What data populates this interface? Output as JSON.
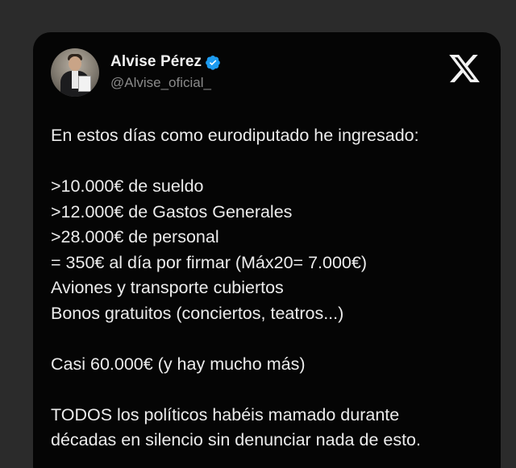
{
  "author": {
    "display_name": "Alvise Pérez",
    "handle": "@Alvise_oficial_",
    "verified_icon": "verified-badge-icon",
    "avatar_icon": "profile-photo"
  },
  "platform": {
    "logo_icon": "x-logo-icon"
  },
  "colors": {
    "background": "#2b2b2b",
    "card": "#050505",
    "text": "#ececec",
    "handle": "#8a8a8a",
    "verified": "#1d9bf0"
  },
  "tweet": {
    "intro": "En estos días como eurodiputado he ingresado:",
    "items": [
      ">10.000€ de sueldo",
      ">12.000€ de Gastos Generales",
      ">28.000€ de personal",
      "= 350€ al día por firmar (Máx20= 7.000€)",
      "Aviones y transporte cubiertos",
      "Bonos gratuitos (conciertos, teatros...)"
    ],
    "total": "Casi 60.000€ (y hay mucho más)",
    "closing_lines": [
      "TODOS los políticos habéis mamado durante",
      "décadas en silencio sin denunciar nada de esto."
    ]
  }
}
